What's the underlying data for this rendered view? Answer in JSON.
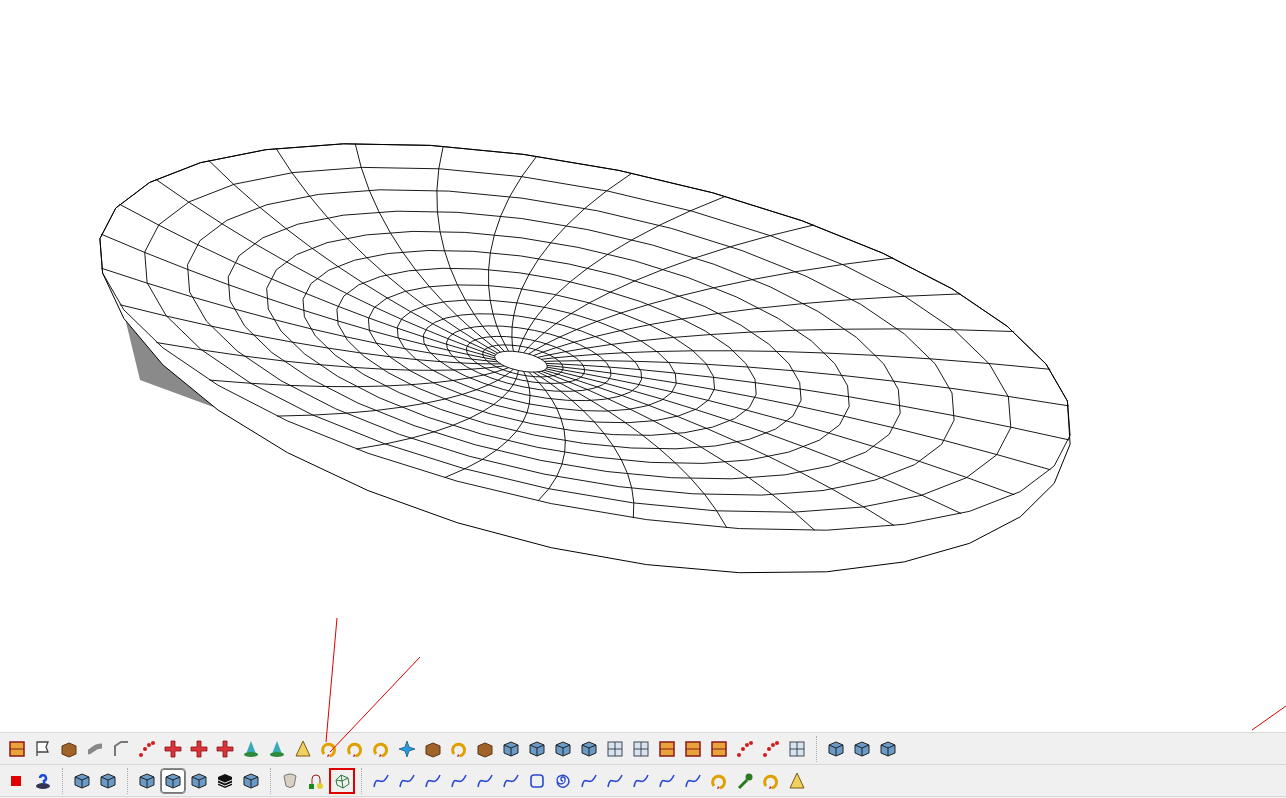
{
  "toolbars": [
    {
      "groups": [
        {
          "buttons": [
            {
              "kind": "panel",
              "selected": false,
              "highlighted": false
            },
            {
              "kind": "flag",
              "selected": false,
              "highlighted": false
            },
            {
              "kind": "box",
              "selected": false,
              "highlighted": false
            },
            {
              "kind": "pipe",
              "selected": false,
              "highlighted": false
            },
            {
              "kind": "fold",
              "selected": false,
              "highlighted": false
            },
            {
              "kind": "dots",
              "selected": false,
              "highlighted": false
            },
            {
              "kind": "cross",
              "selected": false,
              "highlighted": false
            },
            {
              "kind": "cross",
              "selected": false,
              "highlighted": false
            },
            {
              "kind": "cross",
              "selected": false,
              "highlighted": false
            },
            {
              "kind": "cone",
              "selected": false,
              "highlighted": false
            },
            {
              "kind": "cone",
              "selected": false,
              "highlighted": false
            },
            {
              "kind": "triangle",
              "selected": false,
              "highlighted": false
            },
            {
              "kind": "ring",
              "selected": false,
              "highlighted": false
            },
            {
              "kind": "ring",
              "selected": false,
              "highlighted": false
            },
            {
              "kind": "ring",
              "selected": false,
              "highlighted": false
            },
            {
              "kind": "star",
              "selected": false,
              "highlighted": false
            },
            {
              "kind": "box",
              "selected": false,
              "highlighted": false
            },
            {
              "kind": "ring",
              "selected": false,
              "highlighted": false
            },
            {
              "kind": "box",
              "selected": false,
              "highlighted": false
            },
            {
              "kind": "cube",
              "selected": false,
              "highlighted": false
            },
            {
              "kind": "cube",
              "selected": false,
              "highlighted": false
            },
            {
              "kind": "cube",
              "selected": false,
              "highlighted": false
            },
            {
              "kind": "cube",
              "selected": false,
              "highlighted": false
            },
            {
              "kind": "grid",
              "selected": false,
              "highlighted": false
            },
            {
              "kind": "grid",
              "selected": false,
              "highlighted": false
            },
            {
              "kind": "panel",
              "selected": false,
              "highlighted": false
            },
            {
              "kind": "panel",
              "selected": false,
              "highlighted": false
            },
            {
              "kind": "panel",
              "selected": false,
              "highlighted": false
            },
            {
              "kind": "dots",
              "selected": false,
              "highlighted": false
            },
            {
              "kind": "dots",
              "selected": false,
              "highlighted": false
            },
            {
              "kind": "grid",
              "selected": false,
              "highlighted": false
            }
          ]
        },
        {
          "buttons": [
            {
              "kind": "cube",
              "selected": false,
              "highlighted": false
            },
            {
              "kind": "cube",
              "selected": false,
              "highlighted": false
            },
            {
              "kind": "cube",
              "selected": false,
              "highlighted": false
            }
          ]
        }
      ]
    },
    {
      "groups": [
        {
          "buttons": [
            {
              "kind": "stop",
              "selected": false,
              "highlighted": false
            },
            {
              "kind": "help",
              "selected": false,
              "highlighted": false
            }
          ]
        },
        {
          "buttons": [
            {
              "kind": "cube",
              "selected": false,
              "highlighted": false
            },
            {
              "kind": "cube",
              "selected": false,
              "highlighted": false
            }
          ]
        },
        {
          "buttons": [
            {
              "kind": "cube",
              "selected": false,
              "highlighted": false
            },
            {
              "kind": "cube",
              "selected": true,
              "highlighted": false
            },
            {
              "kind": "cube",
              "selected": false,
              "highlighted": false
            },
            {
              "kind": "stripes",
              "selected": false,
              "highlighted": false
            },
            {
              "kind": "cube",
              "selected": false,
              "highlighted": false
            }
          ]
        },
        {
          "buttons": [
            {
              "kind": "shell",
              "selected": false,
              "highlighted": false
            },
            {
              "kind": "node",
              "selected": false,
              "highlighted": false
            },
            {
              "kind": "mesh",
              "selected": false,
              "highlighted": true
            }
          ]
        },
        {
          "buttons": [
            {
              "kind": "curve",
              "selected": false,
              "highlighted": false
            },
            {
              "kind": "curve",
              "selected": false,
              "highlighted": false
            },
            {
              "kind": "curve",
              "selected": false,
              "highlighted": false
            },
            {
              "kind": "curve",
              "selected": false,
              "highlighted": false
            },
            {
              "kind": "curve",
              "selected": false,
              "highlighted": false
            },
            {
              "kind": "curve",
              "selected": false,
              "highlighted": false
            },
            {
              "kind": "square",
              "selected": false,
              "highlighted": false
            },
            {
              "kind": "spiral",
              "selected": false,
              "highlighted": false
            },
            {
              "kind": "curve",
              "selected": false,
              "highlighted": false
            },
            {
              "kind": "curve",
              "selected": false,
              "highlighted": false
            },
            {
              "kind": "curve",
              "selected": false,
              "highlighted": false
            },
            {
              "kind": "curve",
              "selected": false,
              "highlighted": false
            },
            {
              "kind": "curve",
              "selected": false,
              "highlighted": false
            },
            {
              "kind": "ring",
              "selected": false,
              "highlighted": false
            },
            {
              "kind": "wrench",
              "selected": false,
              "highlighted": false
            },
            {
              "kind": "ring",
              "selected": false,
              "highlighted": false
            },
            {
              "kind": "triangle",
              "selected": false,
              "highlighted": false
            }
          ]
        }
      ]
    }
  ]
}
